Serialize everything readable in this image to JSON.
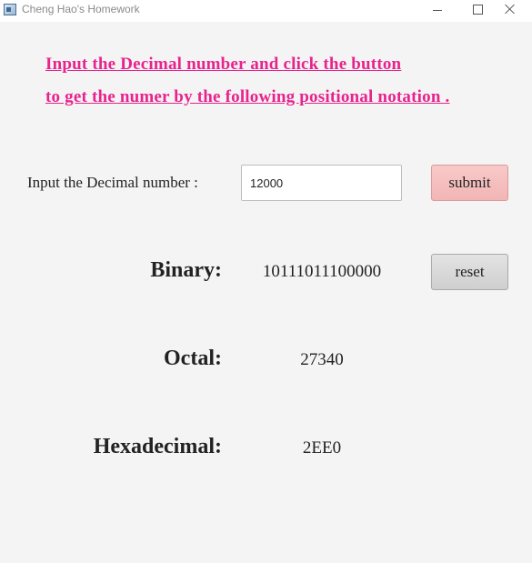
{
  "window": {
    "title": "Cheng Hao's Homework"
  },
  "instructions": {
    "line1": "Input the Decimal number and click the button ",
    "line2": "to get the numer by the following positional notation ."
  },
  "input": {
    "label": "Input the Decimal number :",
    "value": "12000"
  },
  "buttons": {
    "submit": "submit",
    "reset": "reset"
  },
  "results": {
    "binary_label": "Binary:",
    "binary_value": "10111011100000",
    "octal_label": "Octal:",
    "octal_value": "27340",
    "hex_label": "Hexadecimal:",
    "hex_value": "2EE0"
  },
  "colors": {
    "instruction_text": "#e8238e",
    "submit_button": "#f5c0c0",
    "reset_button": "#d9d9d9",
    "background": "#f4f4f4"
  },
  "icons": {
    "app": "app-window-icon",
    "minimize": "minimize-icon",
    "maximize": "maximize-icon",
    "close": "close-icon"
  }
}
